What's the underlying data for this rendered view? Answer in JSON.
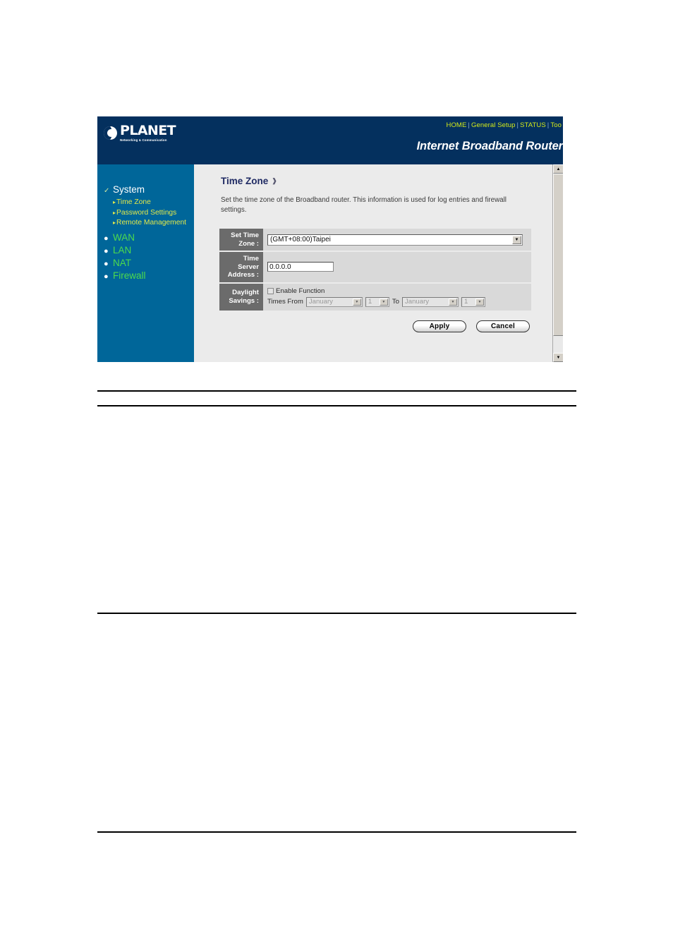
{
  "router_ui": {
    "brand": {
      "name": "PLANET",
      "tagline": "Networking & Communication",
      "logo_icon": "globe-icon"
    },
    "nav_links": [
      "HOME",
      "General Setup",
      "STATUS",
      "Too"
    ],
    "product_title": "Internet Broadband Router",
    "header_bg": "#04305e",
    "sidebar_bg": "#006699",
    "content_bg": "#ebebeb"
  },
  "sidebar": {
    "groups": [
      {
        "label": "System",
        "marker": "check",
        "color": "#ffffff",
        "children": [
          {
            "label": "Time Zone"
          },
          {
            "label": "Password Settings"
          },
          {
            "label": "Remote Management"
          }
        ]
      },
      {
        "label": "WAN",
        "marker": "dot",
        "color": "#4ddb4d",
        "children": []
      },
      {
        "label": "LAN",
        "marker": "dot",
        "color": "#4ddb4d",
        "children": []
      },
      {
        "label": "NAT",
        "marker": "dot",
        "color": "#4ddb4d",
        "children": []
      },
      {
        "label": "Firewall",
        "marker": "dot",
        "color": "#4ddb4d",
        "children": []
      }
    ]
  },
  "main": {
    "heading": "Time Zone",
    "help_icon": "help-icon",
    "description": "Set the time zone of the Broadband router. This information is used for log entries and firewall settings.",
    "fields": {
      "set_time_zone": {
        "label": "Set Time Zone :",
        "value": "(GMT+08:00)Taipei"
      },
      "time_server_address": {
        "label": "Time Server Address :",
        "value": "0.0.0.0"
      },
      "daylight_savings": {
        "label": "Daylight Savings :",
        "enable_label": "Enable Function",
        "enabled": false,
        "times_from_label": "Times From",
        "to_label": "To",
        "from_month": "January",
        "from_day": "1",
        "to_month": "January",
        "to_day": "1"
      }
    },
    "buttons": {
      "apply": "Apply",
      "cancel": "Cancel"
    }
  },
  "scrollbar": {
    "up_arrow": "▲",
    "down_arrow": "▼"
  }
}
